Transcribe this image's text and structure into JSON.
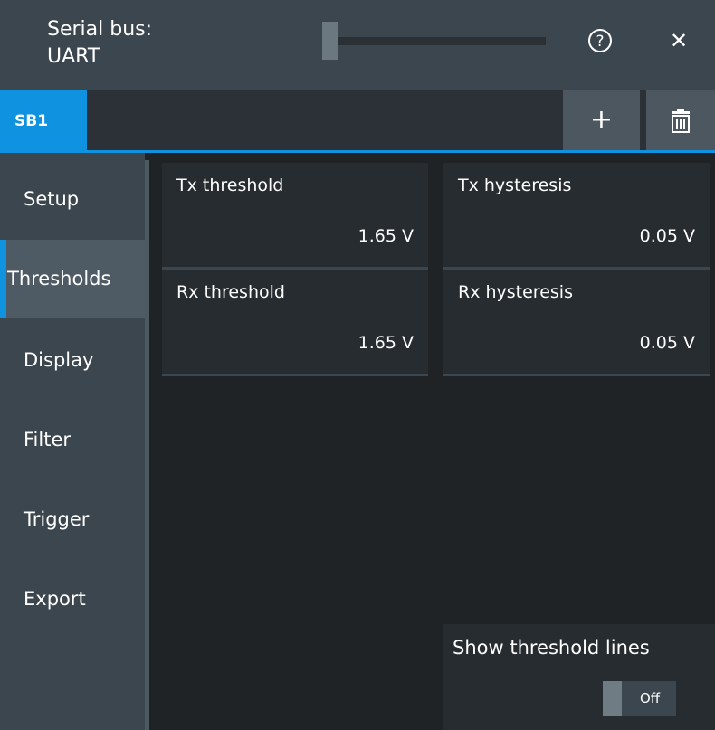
{
  "header": {
    "title_line1": "Serial bus:",
    "title_line2": "UART",
    "help_icon": "question-circle-icon",
    "close_icon": "close-icon",
    "close_glyph": "✕"
  },
  "tabs": {
    "items": [
      {
        "label": "SB1"
      }
    ],
    "add_glyph": "+",
    "add_icon": "plus-icon",
    "delete_icon": "trash-icon"
  },
  "sidebar": {
    "items": [
      {
        "label": "Setup"
      },
      {
        "label": "Thresholds"
      },
      {
        "label": "Display"
      },
      {
        "label": "Filter"
      },
      {
        "label": "Trigger"
      },
      {
        "label": "Export"
      }
    ],
    "active": "Thresholds"
  },
  "fields": {
    "tx_threshold": {
      "label": "Tx threshold",
      "value": "1.65 V"
    },
    "tx_hysteresis": {
      "label": "Tx hysteresis",
      "value": "0.05 V"
    },
    "rx_threshold": {
      "label": "Rx threshold",
      "value": "1.65 V"
    },
    "rx_hysteresis": {
      "label": "Rx hysteresis",
      "value": "0.05 V"
    }
  },
  "show_threshold_lines": {
    "label": "Show threshold lines",
    "state": "Off"
  },
  "colors": {
    "accent": "#0f92e0",
    "header_bg": "#3c464e",
    "content_bg": "#1f2326"
  }
}
